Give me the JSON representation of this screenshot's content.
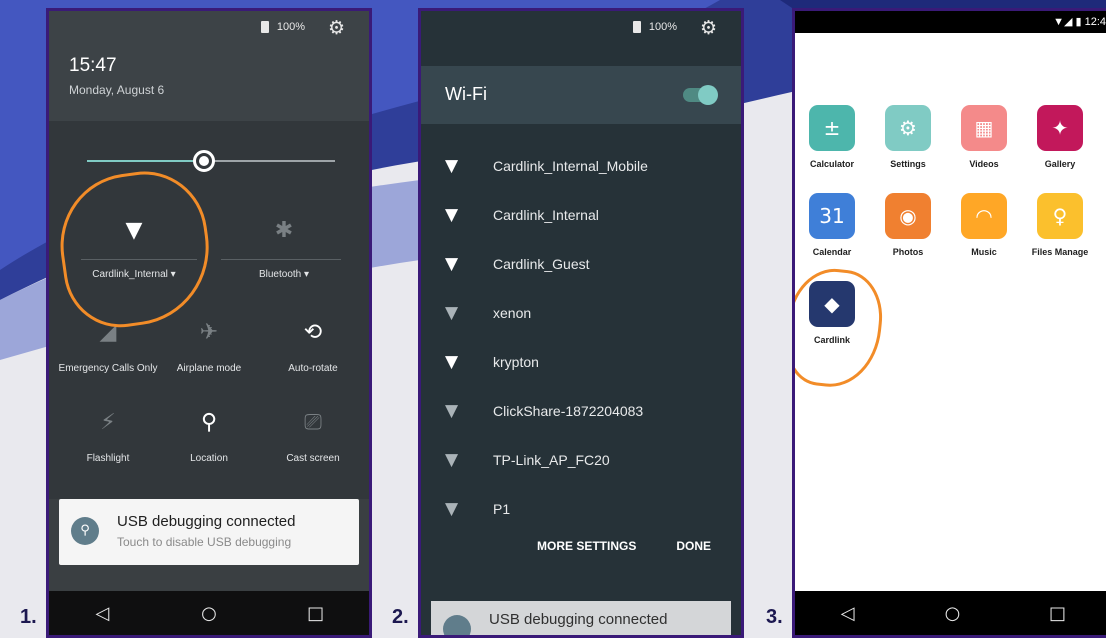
{
  "steps": [
    "1.",
    "2.",
    "3."
  ],
  "phone1": {
    "status": {
      "battery": "100%",
      "settings_icon": "gear-icon"
    },
    "time": "15:47",
    "date": "Monday, August 6",
    "brightness": 0.47,
    "tiles": [
      {
        "label": "Cardlink_Internal ▾",
        "icon": "wifi-icon"
      },
      {
        "label": "Bluetooth ▾",
        "icon": "bluetooth-off-icon"
      },
      {
        "label": "Emergency Calls Only",
        "icon": "no-signal-icon"
      },
      {
        "label": "Airplane mode",
        "icon": "airplane-icon"
      },
      {
        "label": "Auto-rotate",
        "icon": "rotate-icon"
      },
      {
        "label": "Flashlight",
        "icon": "flashlight-icon"
      },
      {
        "label": "Location",
        "icon": "location-icon"
      },
      {
        "label": "Cast screen",
        "icon": "cast-icon"
      }
    ],
    "notification": {
      "title": "USB debugging connected",
      "text": "Touch to disable USB debugging"
    }
  },
  "phone2": {
    "status": {
      "battery": "100%"
    },
    "title": "Wi-Fi",
    "toggle_on": true,
    "networks": [
      {
        "name": "Cardlink_Internal_Mobile",
        "strength": "full"
      },
      {
        "name": "Cardlink_Internal",
        "strength": "full"
      },
      {
        "name": "Cardlink_Guest",
        "strength": "full"
      },
      {
        "name": "xenon",
        "strength": "weak"
      },
      {
        "name": "krypton",
        "strength": "full"
      },
      {
        "name": "ClickShare-1872204083",
        "strength": "weak"
      },
      {
        "name": "TP-Link_AP_FC20",
        "strength": "weak"
      },
      {
        "name": "P1",
        "strength": "weak"
      }
    ],
    "more_settings": "MORE SETTINGS",
    "done": "DONE",
    "notification_title": "USB debugging connected"
  },
  "phone3": {
    "status_time": "12:4",
    "apps": [
      {
        "name": "Calculator",
        "color": "#4db6ac",
        "glyph": "±"
      },
      {
        "name": "Settings",
        "color": "#80cbc4",
        "glyph": "⚙"
      },
      {
        "name": "Videos",
        "color": "#f48a8a",
        "glyph": "▦"
      },
      {
        "name": "Gallery",
        "color": "#c2185b",
        "glyph": "✦"
      },
      {
        "name": "Calendar",
        "color": "#3f7fd8",
        "glyph": "31"
      },
      {
        "name": "Photos",
        "color": "#f08030",
        "glyph": "◉"
      },
      {
        "name": "Music",
        "color": "#ffa726",
        "glyph": "◠"
      },
      {
        "name": "Files Manage",
        "color": "#fbc02d",
        "glyph": "♀"
      },
      {
        "name": "Cardlink",
        "color": "#25386e",
        "glyph": "◆"
      }
    ]
  },
  "nav": {
    "back": "◁",
    "home": "○",
    "recents": "□"
  },
  "colors": {
    "frame": "#3a1a78",
    "highlight": "#f28c28",
    "accent": "#80cbc4"
  }
}
